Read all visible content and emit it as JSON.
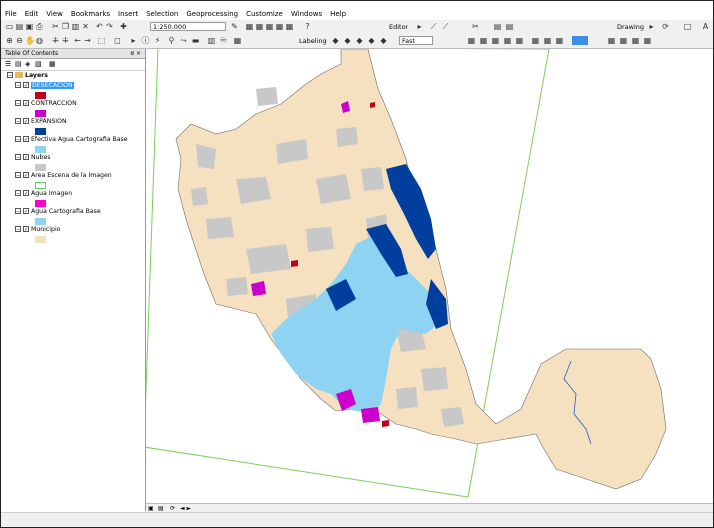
{
  "menu": [
    "File",
    "Edit",
    "View",
    "Bookmarks",
    "Insert",
    "Selection",
    "Geoprocessing",
    "Customize",
    "Windows",
    "Help"
  ],
  "toolbar": {
    "scale": "1:250.000",
    "editor_label": "Editor",
    "drawing_label": "Drawing",
    "labeling_label": "Labeling",
    "quality": "Fast"
  },
  "toc": {
    "title": "Table Of Contents",
    "pin": "ȣ ×",
    "root": "Layers",
    "layers": [
      {
        "name": "DESECACION",
        "color": "#c0001e",
        "selected": true
      },
      {
        "name": "CONTRACCION",
        "color": "#cc00cc",
        "selected": false
      },
      {
        "name": "EXPANSION",
        "color": "#003f9e",
        "selected": false
      },
      {
        "name": "Efectiva Agua Cartografia Base",
        "color": "#8fd3f2",
        "selected": false
      },
      {
        "name": "Nubes",
        "color": "#c8c8c8",
        "selected": false
      },
      {
        "name": "Area Escena de la Imagen",
        "color": "#ffffff",
        "outline": "#66cc66",
        "selected": false
      },
      {
        "name": "Agua Imagen",
        "color": "#ff00cc",
        "selected": false
      },
      {
        "name": "Agua Cartografia Base",
        "color": "#8fd3f2",
        "selected": false
      },
      {
        "name": "Municipio",
        "color": "#f5e1c0",
        "selected": false
      }
    ]
  },
  "status": {
    "page_nav": "◄ ►"
  }
}
